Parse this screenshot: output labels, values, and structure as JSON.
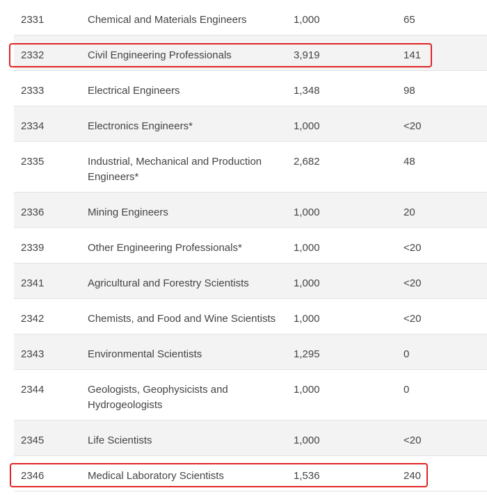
{
  "table": {
    "rows": [
      {
        "code": "2331",
        "occupation": "Chemical and Materials Engineers",
        "min_points": "1,000",
        "nominations": "65"
      },
      {
        "code": "2332",
        "occupation": "Civil Engineering Professionals",
        "min_points": "3,919",
        "nominations": "141"
      },
      {
        "code": "2333",
        "occupation": "Electrical Engineers",
        "min_points": "1,348",
        "nominations": "98"
      },
      {
        "code": "2334",
        "occupation": "Electronics Engineers*",
        "min_points": "1,000",
        "nominations": "<20"
      },
      {
        "code": "2335",
        "occupation": "Industrial, Mechanical and Production Engineers*",
        "min_points": "2,682",
        "nominations": "48"
      },
      {
        "code": "2336",
        "occupation": "Mining Engineers",
        "min_points": "1,000",
        "nominations": "20"
      },
      {
        "code": "2339",
        "occupation": "Other Engineering Professionals*",
        "min_points": "1,000",
        "nominations": "<20"
      },
      {
        "code": "2341",
        "occupation": "Agricultural and Forestry Scientists",
        "min_points": "1,000",
        "nominations": "<20"
      },
      {
        "code": "2342",
        "occupation": "Chemists, and Food and Wine Scientists",
        "min_points": "1,000",
        "nominations": "<20"
      },
      {
        "code": "2343",
        "occupation": "Environmental Scientists",
        "min_points": "1,295",
        "nominations": "0"
      },
      {
        "code": "2344",
        "occupation": "Geologists, Geophysicists and Hydrogeologists",
        "min_points": "1,000",
        "nominations": "0"
      },
      {
        "code": "2345",
        "occupation": "Life Scientists",
        "min_points": "1,000",
        "nominations": "<20"
      },
      {
        "code": "2346",
        "occupation": "Medical Laboratory Scientists",
        "min_points": "1,536",
        "nominations": "240"
      }
    ]
  },
  "colors": {
    "highlight_border": "#e02424",
    "alt_row_background": "#f3f3f3",
    "text": "#444444"
  }
}
